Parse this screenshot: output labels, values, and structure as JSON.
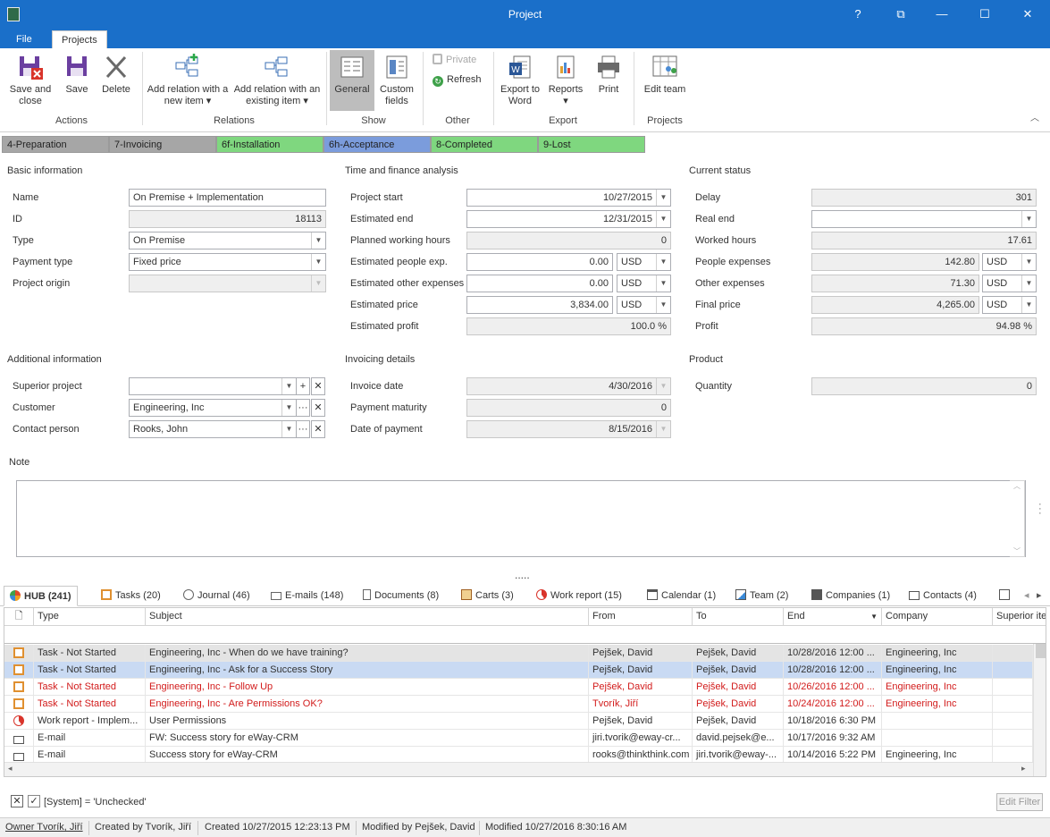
{
  "window": {
    "title": "Project",
    "help": "?",
    "restore_label": "⧉",
    "minimize": "—",
    "maximize": "☐",
    "close": "✕"
  },
  "tabs": [
    {
      "label": "File"
    },
    {
      "label": "Projects"
    }
  ],
  "ribbon": {
    "actions": {
      "save_close": "Save and close",
      "save": "Save",
      "delete": "Delete",
      "group": "Actions"
    },
    "relations": {
      "add_new": "Add relation with a new item ▾",
      "add_existing": "Add relation with an existing item ▾",
      "group": "Relations"
    },
    "show": {
      "general": "General",
      "custom_fields": "Custom fields",
      "group": "Show"
    },
    "other": {
      "private": "Private",
      "refresh": "Refresh",
      "group": "Other"
    },
    "export": {
      "export_word": "Export to Word",
      "reports": "Reports ▾",
      "print": "Print",
      "group": "Export"
    },
    "projects": {
      "edit_team": "Edit team",
      "group": "Projects"
    }
  },
  "stages": [
    {
      "label": "4-Preparation",
      "color": "#a6a6a6"
    },
    {
      "label": "7-Invoicing",
      "color": "#a6a6a6"
    },
    {
      "label": "6f-Installation",
      "color": "#7fd77f"
    },
    {
      "label": "6h-Acceptance",
      "color": "#7b9cdc"
    },
    {
      "label": "8-Completed",
      "color": "#7fd77f"
    },
    {
      "label": "9-Lost",
      "color": "#7fd77f"
    }
  ],
  "basic": {
    "title": "Basic information",
    "name_label": "Name",
    "name": "On Premise + Implementation",
    "id_label": "ID",
    "id": "18113",
    "type_label": "Type",
    "type": "On Premise",
    "payment_label": "Payment type",
    "payment": "Fixed price",
    "origin_label": "Project origin",
    "origin": ""
  },
  "finance": {
    "title": "Time and finance analysis",
    "start_label": "Project start",
    "start": "10/27/2015",
    "end_label": "Estimated end",
    "end": "12/31/2015",
    "hours_label": "Planned working hours",
    "hours": "0",
    "people_label": "Estimated people exp.",
    "people": "0.00",
    "people_cur": "USD",
    "other_label": "Estimated other expenses",
    "other": "0.00",
    "other_cur": "USD",
    "price_label": "Estimated price",
    "price": "3,834.00",
    "price_cur": "USD",
    "profit_label": "Estimated profit",
    "profit": "100.0 %"
  },
  "status": {
    "title": "Current status",
    "delay_label": "Delay",
    "delay": "301",
    "real_end_label": "Real end",
    "real_end": "",
    "worked_label": "Worked hours",
    "worked": "17.61",
    "people_label": "People expenses",
    "people": "142.80",
    "people_cur": "USD",
    "other_label": "Other expenses",
    "other": "71.30",
    "other_cur": "USD",
    "final_label": "Final price",
    "final": "4,265.00",
    "final_cur": "USD",
    "profit_label": "Profit",
    "profit": "94.98 %"
  },
  "additional": {
    "title": "Additional information",
    "superior_label": "Superior project",
    "superior": "",
    "customer_label": "Customer",
    "customer": "Engineering, Inc",
    "contact_label": "Contact person",
    "contact": "Rooks, John"
  },
  "invoicing": {
    "title": "Invoicing details",
    "date_label": "Invoice date",
    "date": "4/30/2016",
    "maturity_label": "Payment maturity",
    "maturity": "0",
    "payment_label": "Date of payment",
    "payment": "8/15/2016"
  },
  "product": {
    "title": "Product",
    "qty_label": "Quantity",
    "qty": "0"
  },
  "note": {
    "label": "Note",
    "value": ""
  },
  "splitter": ".....",
  "bottom_tabs": [
    {
      "label": "HUB (241)",
      "icon": "hub-icon"
    },
    {
      "label": "Tasks (20)",
      "icon": "task-icon"
    },
    {
      "label": "Journal (46)",
      "icon": "journal-icon"
    },
    {
      "label": "E-mails (148)",
      "icon": "email-icon"
    },
    {
      "label": "Documents (8)",
      "icon": "document-icon"
    },
    {
      "label": "Carts (3)",
      "icon": "cart-icon"
    },
    {
      "label": "Work report (15)",
      "icon": "work-report-icon"
    },
    {
      "label": "Calendar (1)",
      "icon": "calendar-icon"
    },
    {
      "label": "Team (2)",
      "icon": "team-icon"
    },
    {
      "label": "Companies (1)",
      "icon": "company-icon"
    },
    {
      "label": "Contacts (4)",
      "icon": "contact-icon"
    }
  ],
  "grid": {
    "columns": [
      "Type",
      "Subject",
      "From",
      "To",
      "End",
      "Company",
      "Superior ite"
    ],
    "rows": [
      {
        "type": "Task - Not Started",
        "subject": "Engineering, Inc - When do we have training?",
        "from": "Pejšek, David",
        "to": "Pejšek, David",
        "end": "10/28/2016 12:00 ...",
        "company": "Engineering, Inc",
        "icon": "task-icon"
      },
      {
        "type": "Task - Not Started",
        "subject": "Engineering, Inc - Ask for a Success Story",
        "from": "Pejšek, David",
        "to": "Pejšek, David",
        "end": "10/28/2016 12:00 ...",
        "company": "Engineering, Inc",
        "icon": "task-icon"
      },
      {
        "type": "Task - Not Started",
        "subject": "Engineering, Inc - Follow Up",
        "from": "Pejšek, David",
        "to": "Pejšek, David",
        "end": "10/26/2016 12:00 ...",
        "company": "Engineering, Inc",
        "icon": "task-icon"
      },
      {
        "type": "Task - Not Started",
        "subject": "Engineering, Inc - Are Permissions OK?",
        "from": "Tvorík, Jiří",
        "to": "Pejšek, David",
        "end": "10/24/2016 12:00 ...",
        "company": "Engineering, Inc",
        "icon": "task-icon"
      },
      {
        "type": "Work report - Implem...",
        "subject": "User Permissions",
        "from": "Pejšek, David",
        "to": "Pejšek, David",
        "end": "10/18/2016 6:30 PM",
        "company": "",
        "icon": "work-report-icon"
      },
      {
        "type": "E-mail",
        "subject": "FW: Success story for eWay-CRM",
        "from": "jiri.tvorik@eway-cr...",
        "to": "david.pejsek@e...",
        "end": "10/17/2016 9:32 AM",
        "company": "",
        "icon": "email-icon"
      },
      {
        "type": "E-mail",
        "subject": "Success story for eWay-CRM",
        "from": "rooks@thinkthink.com",
        "to": "jiri.tvorik@eway-...",
        "end": "10/14/2016 5:22 PM",
        "company": "Engineering, Inc",
        "icon": "email-icon"
      }
    ]
  },
  "filter": {
    "text": "[System] = 'Unchecked'",
    "edit_button": "Edit Filter"
  },
  "statusbar": {
    "owner": "Owner Tvorík, Jiří",
    "created_by": "Created by Tvorík, Jiří",
    "created": "Created 10/27/2015 12:23:13 PM",
    "modified_by": "Modified by Pejšek, David",
    "modified": "Modified 10/27/2016 8:30:16 AM"
  }
}
